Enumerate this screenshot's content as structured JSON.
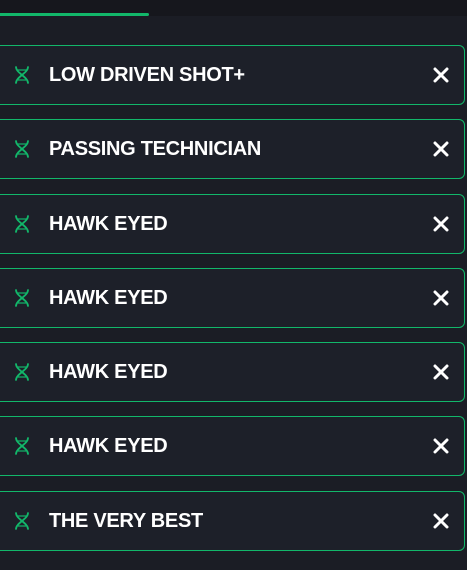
{
  "theme": {
    "accent": "#12b76a",
    "background": "#1b1d25",
    "row_background": "#1d2029",
    "text": "#ffffff"
  },
  "traits": [
    {
      "label": "LOW DRIVEN SHOT+",
      "icon": "dna-icon",
      "action_icon": "close-icon"
    },
    {
      "label": "PASSING TECHNICIAN",
      "icon": "dna-icon",
      "action_icon": "close-icon"
    },
    {
      "label": "HAWK EYED",
      "icon": "dna-icon",
      "action_icon": "close-icon"
    },
    {
      "label": "HAWK EYED",
      "icon": "dna-icon",
      "action_icon": "close-icon"
    },
    {
      "label": "HAWK EYED",
      "icon": "dna-icon",
      "action_icon": "close-icon"
    },
    {
      "label": "HAWK EYED",
      "icon": "dna-icon",
      "action_icon": "close-icon"
    },
    {
      "label": "THE VERY BEST",
      "icon": "dna-icon",
      "action_icon": "close-icon"
    }
  ]
}
